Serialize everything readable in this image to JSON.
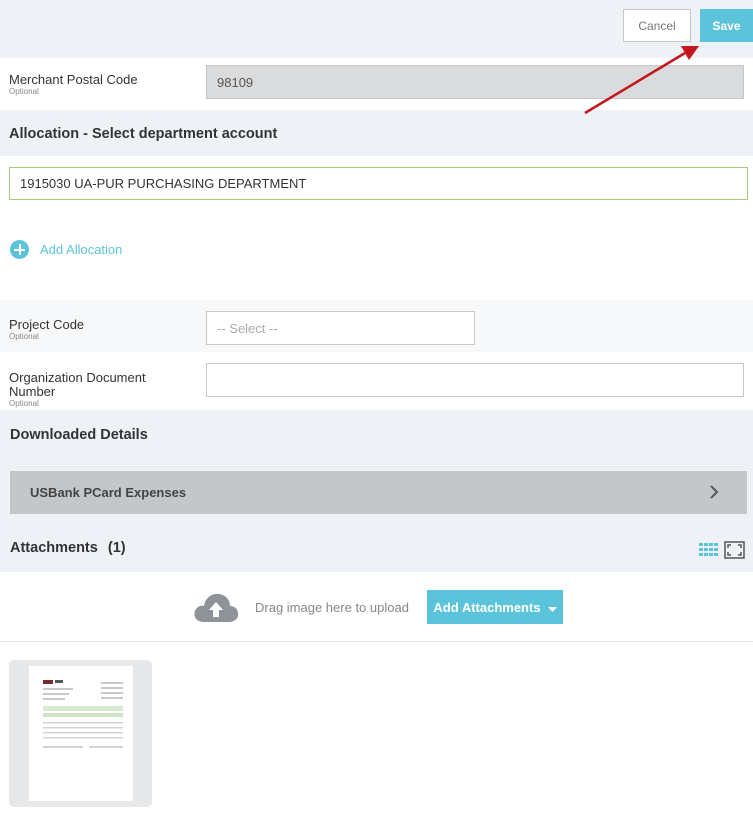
{
  "toolbar": {
    "cancel_label": "Cancel",
    "save_label": "Save"
  },
  "merchant_postal": {
    "label": "Merchant Postal Code",
    "sub": "Optional",
    "value": "98109"
  },
  "allocation": {
    "title": "Allocation - Select department account",
    "value": "1915030 UA-PUR PURCHASING DEPARTMENT",
    "add_label": "Add Allocation"
  },
  "project_code": {
    "label": "Project Code",
    "sub": "Optional",
    "placeholder": "-- Select --"
  },
  "org_doc": {
    "label_line1": "Organization Document",
    "label_line2": "Number",
    "sub": "Optional",
    "value": ""
  },
  "downloaded": {
    "title": "Downloaded Details",
    "card_label": "USBank PCard Expenses"
  },
  "attachments": {
    "title": "Attachments",
    "count": "(1)",
    "drag_text": "Drag image here to upload",
    "add_button": "Add Attachments"
  },
  "colors": {
    "accent": "#5bc4db",
    "field_bg": "#d9dbdd",
    "band": "#eef2f7",
    "arrow": "#c4161c"
  }
}
